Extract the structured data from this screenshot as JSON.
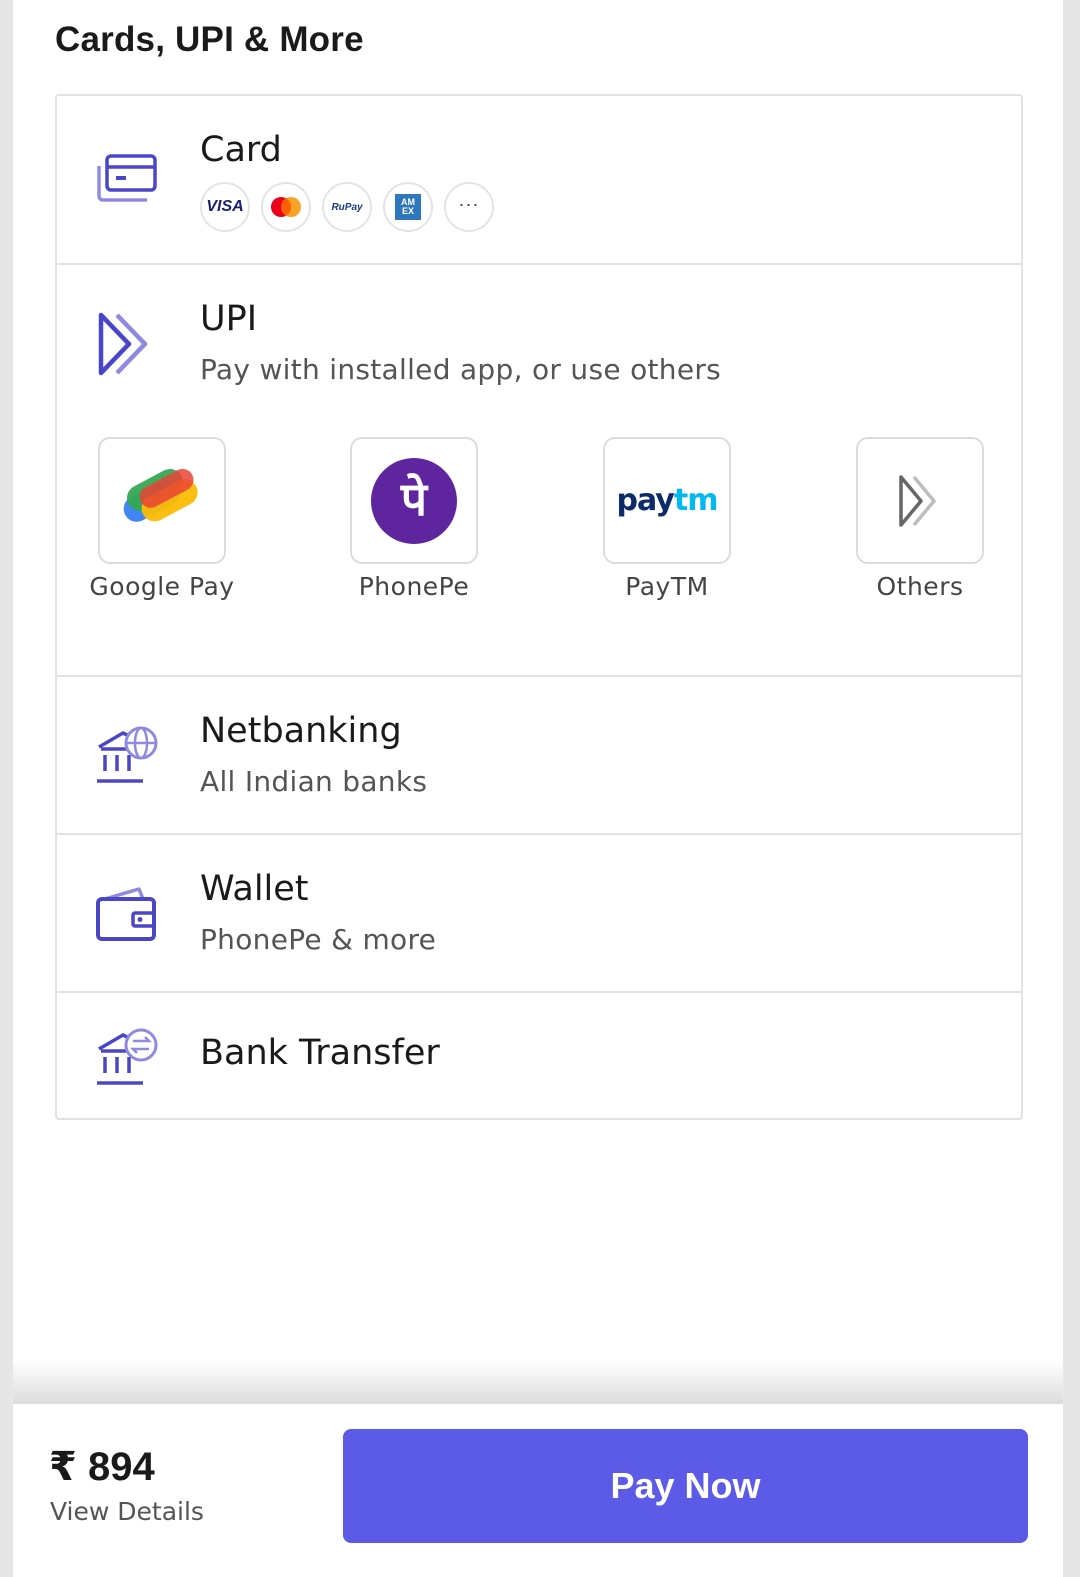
{
  "section": {
    "title": "Cards, UPI & More"
  },
  "card": {
    "title": "Card",
    "brands": [
      {
        "name": "visa",
        "label": "VISA"
      },
      {
        "name": "mastercard",
        "label": ""
      },
      {
        "name": "rupay",
        "label": "RuPay"
      },
      {
        "name": "amex",
        "label": "AM EX"
      },
      {
        "name": "more",
        "label": "···"
      }
    ]
  },
  "upi": {
    "title": "UPI",
    "subtitle": "Pay with installed app, or use others",
    "apps": [
      {
        "label": "Google Pay"
      },
      {
        "label": "PhonePe",
        "glyph": "पे"
      },
      {
        "label": "PayTM",
        "logo_a": "pay",
        "logo_b": "tm"
      },
      {
        "label": "Others"
      }
    ]
  },
  "netbanking": {
    "title": "Netbanking",
    "subtitle": "All Indian banks"
  },
  "wallet": {
    "title": "Wallet",
    "subtitle": "PhonePe & more"
  },
  "bank_transfer": {
    "title": "Bank Transfer"
  },
  "footer": {
    "amount": "₹ 894",
    "view_details": "View Details",
    "pay_label": "Pay Now"
  },
  "colors": {
    "accent": "#5b5be8",
    "icon": "#4b46c8",
    "phonepe": "#5f259f",
    "paytm_dark": "#0d2b6b",
    "paytm_light": "#00b9f1"
  }
}
